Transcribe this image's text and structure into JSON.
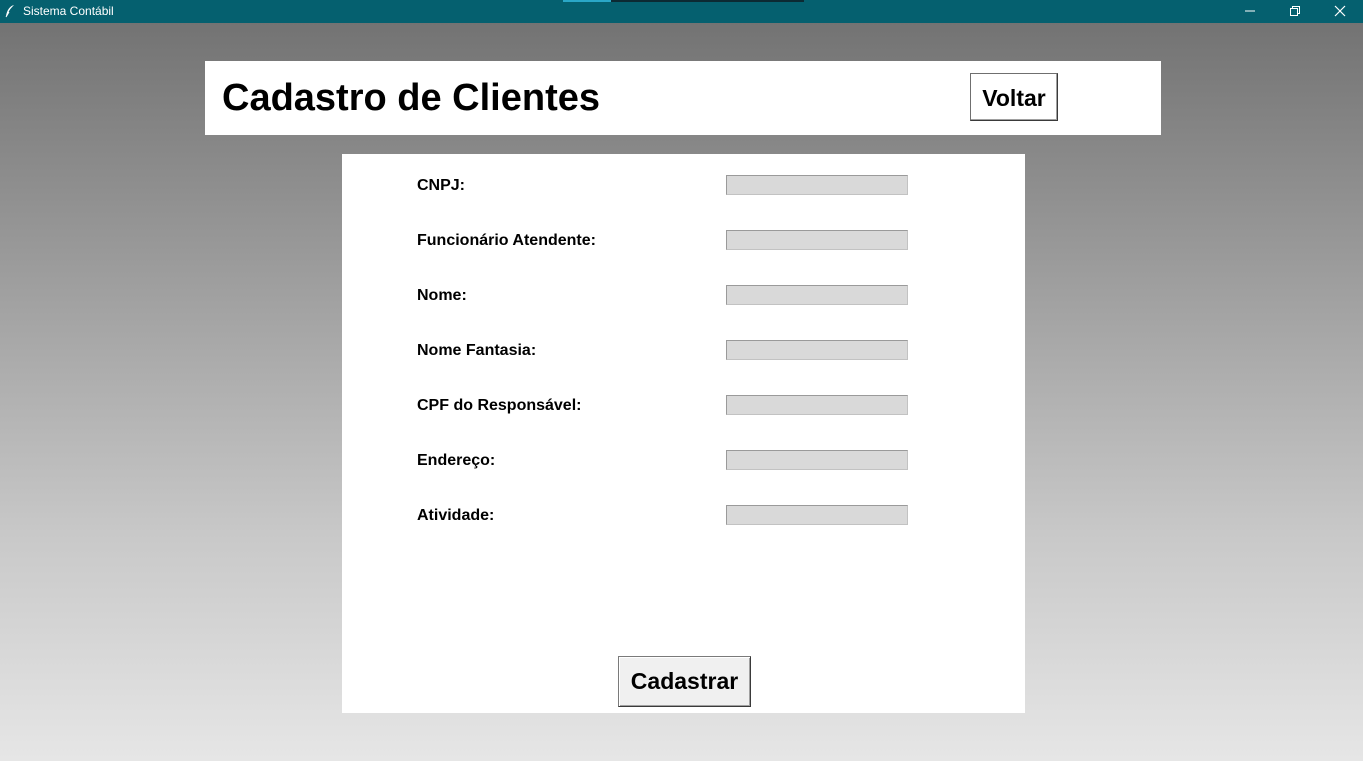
{
  "window": {
    "title": "Sistema Contábil",
    "icon": "feather-icon",
    "controls": {
      "minimize_icon": "minimize-icon",
      "restore_icon": "restore-icon",
      "close_icon": "close-icon"
    }
  },
  "header": {
    "title": "Cadastro de Clientes",
    "back_label": "Voltar"
  },
  "form": {
    "fields": [
      {
        "label": "CNPJ:",
        "value": ""
      },
      {
        "label": "Funcionário Atendente:",
        "value": ""
      },
      {
        "label": "Nome:",
        "value": ""
      },
      {
        "label": "Nome Fantasia:",
        "value": ""
      },
      {
        "label": "CPF do Responsável:",
        "value": ""
      },
      {
        "label": "Endereço:",
        "value": ""
      },
      {
        "label": "Atividade:",
        "value": ""
      }
    ],
    "submit_label": "Cadastrar"
  },
  "colors": {
    "titlebar": "#05606f",
    "input_background": "#d9d9d9",
    "panel_background": "#ffffff"
  }
}
